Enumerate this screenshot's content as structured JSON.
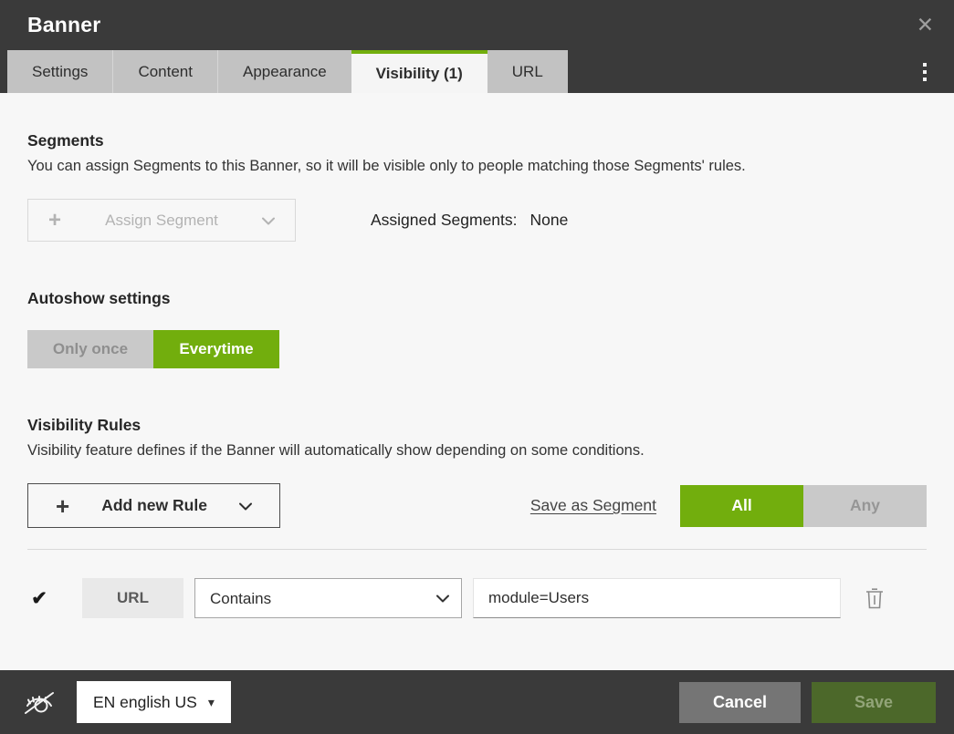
{
  "header": {
    "title": "Banner"
  },
  "tabs": {
    "items": [
      {
        "label": "Settings",
        "active": false
      },
      {
        "label": "Content",
        "active": false
      },
      {
        "label": "Appearance",
        "active": false
      },
      {
        "label": "Visibility (1)",
        "active": true
      },
      {
        "label": "URL",
        "active": false
      }
    ]
  },
  "segments": {
    "heading": "Segments",
    "description": "You can assign Segments to this Banner, so it will be visible only to people matching those Segments' rules.",
    "assign_button_label": "Assign Segment",
    "assigned_label": "Assigned Segments:",
    "assigned_value": "None"
  },
  "autoshow": {
    "heading": "Autoshow settings",
    "options": [
      {
        "label": "Only once",
        "active": false
      },
      {
        "label": "Everytime",
        "active": true
      }
    ]
  },
  "visibility_rules": {
    "heading": "Visibility Rules",
    "description": "Visibility feature defines if the Banner will automatically show depending on some conditions.",
    "add_button_label": "Add new Rule",
    "save_as_segment_label": "Save as Segment",
    "match_options": [
      {
        "label": "All",
        "active": true
      },
      {
        "label": "Any",
        "active": false
      }
    ],
    "rule": {
      "checked": true,
      "field": "URL",
      "operator": "Contains",
      "value": "module=Users"
    }
  },
  "footer": {
    "language_label": "EN english US",
    "cancel_label": "Cancel",
    "save_label": "Save"
  },
  "icons": {
    "close": "✕",
    "plus": "+",
    "checkmark": "✔",
    "caret_down": "▾"
  },
  "colors": {
    "accent_green": "#72ae0d",
    "header_dark": "#3a3a3a",
    "save_button_green": "#4c682a",
    "inactive_gray": "#c9c9c9"
  }
}
